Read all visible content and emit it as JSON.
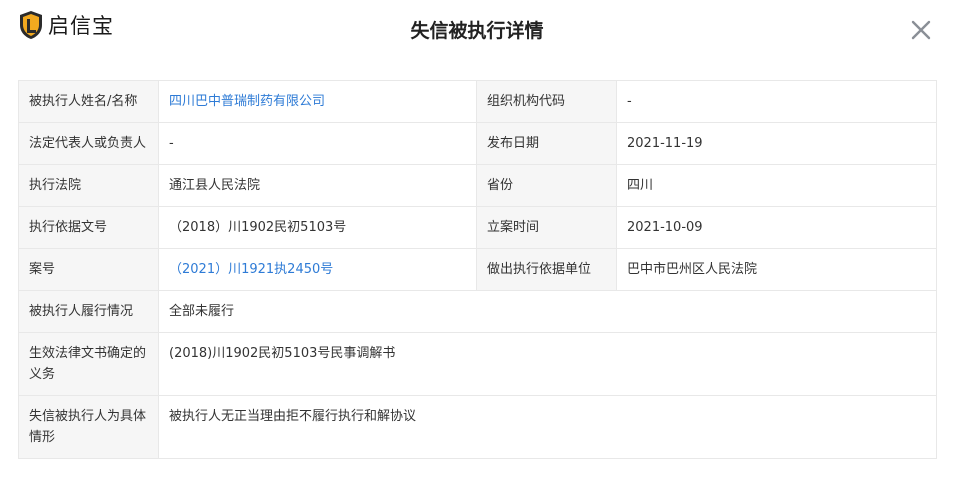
{
  "brand": {
    "name": "启信宝",
    "accent": "#f2a91f",
    "dark": "#2b2b2b"
  },
  "header": {
    "title": "失信被执行详情",
    "close_icon": "close-icon"
  },
  "rows": {
    "r1": {
      "l1": "被执行人姓名/名称",
      "v1": "四川巴中普瑞制药有限公司",
      "l2": "组织机构代码",
      "v2": "-"
    },
    "r2": {
      "l1": "法定代表人或负责人",
      "v1": "-",
      "l2": "发布日期",
      "v2": "2021-11-19"
    },
    "r3": {
      "l1": "执行法院",
      "v1": "通江县人民法院",
      "l2": "省份",
      "v2": "四川"
    },
    "r4": {
      "l1": "执行依据文号",
      "v1": "（2018）川1902民初5103号",
      "l2": "立案时间",
      "v2": "2021-10-09"
    },
    "r5": {
      "l1": "案号",
      "v1": "（2021）川1921执2450号",
      "l2": "做出执行依据单位",
      "v2": "巴中市巴州区人民法院"
    },
    "r6": {
      "l1": "被执行人履行情况",
      "v1": "全部未履行"
    },
    "r7": {
      "l1": "生效法律文书确定的义务",
      "v1": "(2018)川1902民初5103号民事调解书"
    },
    "r8": {
      "l1": "失信被执行人为具体情形",
      "v1": "被执行人无正当理由拒不履行执行和解协议"
    }
  },
  "link_color": "#2e7bd6"
}
